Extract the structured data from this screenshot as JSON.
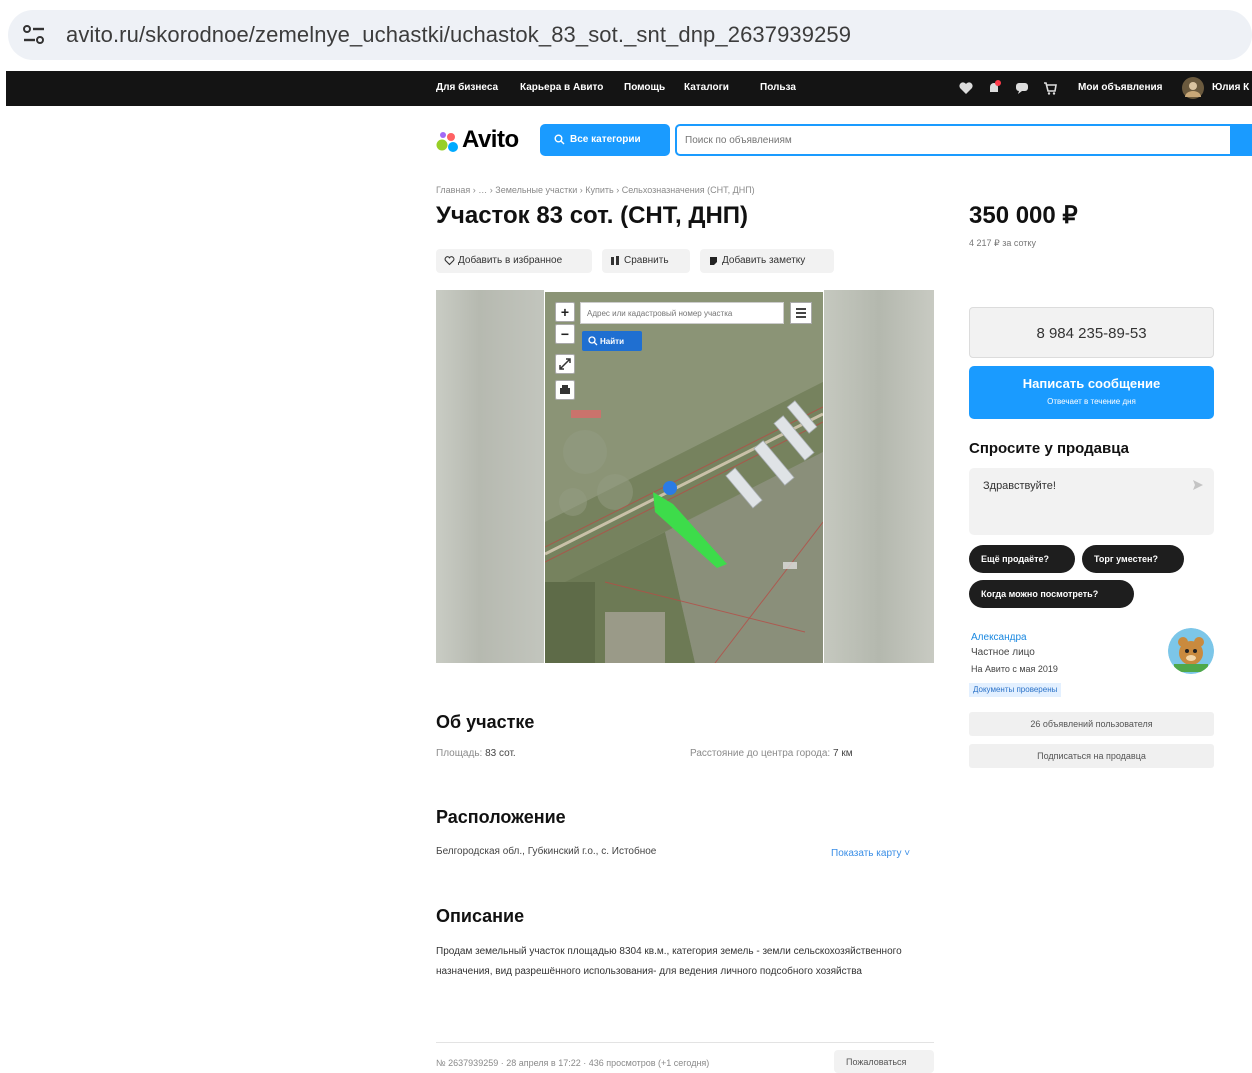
{
  "browser": {
    "url": "avito.ru/skorodnoe/zemelnye_uchastki/uchastok_83_sot._snt_dnp_2637939259",
    "site_icon": "tune-icon"
  },
  "topnav": {
    "links": [
      "Для бизнеса",
      "Карьера в Авито",
      "Помощь",
      "Каталоги",
      "Польза"
    ],
    "my_ads": "Мои объявления",
    "user": "Юлия К",
    "icons": [
      "heart-icon",
      "bell-icon",
      "chat-icon",
      "cart-icon"
    ],
    "bg": "#141414"
  },
  "header": {
    "logo": "Avito",
    "categories_button": "Все категории",
    "search_placeholder": "Поиск по объявлениям",
    "accent": "#1a9bff"
  },
  "breadcrumb": "Главная › … › Земельные участки › Купить › Сельхозназначения (СНТ, ДНП)",
  "title": "Участок 83 сот. (СНТ, ДНП)",
  "actions": {
    "favorite": "Добавить в избранное",
    "compare": "Сравнить",
    "note": "Добавить заметку"
  },
  "map": {
    "zoom_in": "+",
    "zoom_out": "−",
    "input_placeholder": "Адрес или кадастровый номер участка",
    "find_button": "Найти",
    "plot_color": "#3ddc4a"
  },
  "about": {
    "heading": "Об участке",
    "area_label": "Площадь:",
    "area_value": "83 сот.",
    "distance_label": "Расстояние до центра города:",
    "distance_value": "7 км"
  },
  "location": {
    "heading": "Расположение",
    "address": "Белгородская обл., Губкинский г.о., с. Истобное",
    "show_map": "Показать карту ˅"
  },
  "description": {
    "heading": "Описание",
    "text": "Продам земельный участок площадью 8304 кв.м., категория земель - земли сельскохозяйственного назначения, вид разрешённого использования- для ведения личного подсобного хозяйства"
  },
  "footer": {
    "meta": "№ 2637939259 · 28 апреля в 17:22 · 436 просмотров (+1 сегодня)",
    "complain": "Пожаловаться"
  },
  "sidebar": {
    "price": "350 000 ₽",
    "price_per_area": "4 217 ₽ за сотку",
    "phone": "8 984 235-89-53",
    "message_button": "Написать сообщение",
    "message_sub": "Отвечает в течение дня",
    "ask_heading": "Спросите у продавца",
    "ask_placeholder": "Здравствуйте!",
    "chips": [
      "Ещё продаёте?",
      "Торг уместен?",
      "Когда можно посмотреть?"
    ],
    "seller": {
      "name": "Александра",
      "type": "Частное лицо",
      "since": "На Авито с мая 2019",
      "badge": "Документы проверены"
    },
    "seller_ads": "26 объявлений пользователя",
    "subscribe": "Подписаться на продавца"
  }
}
